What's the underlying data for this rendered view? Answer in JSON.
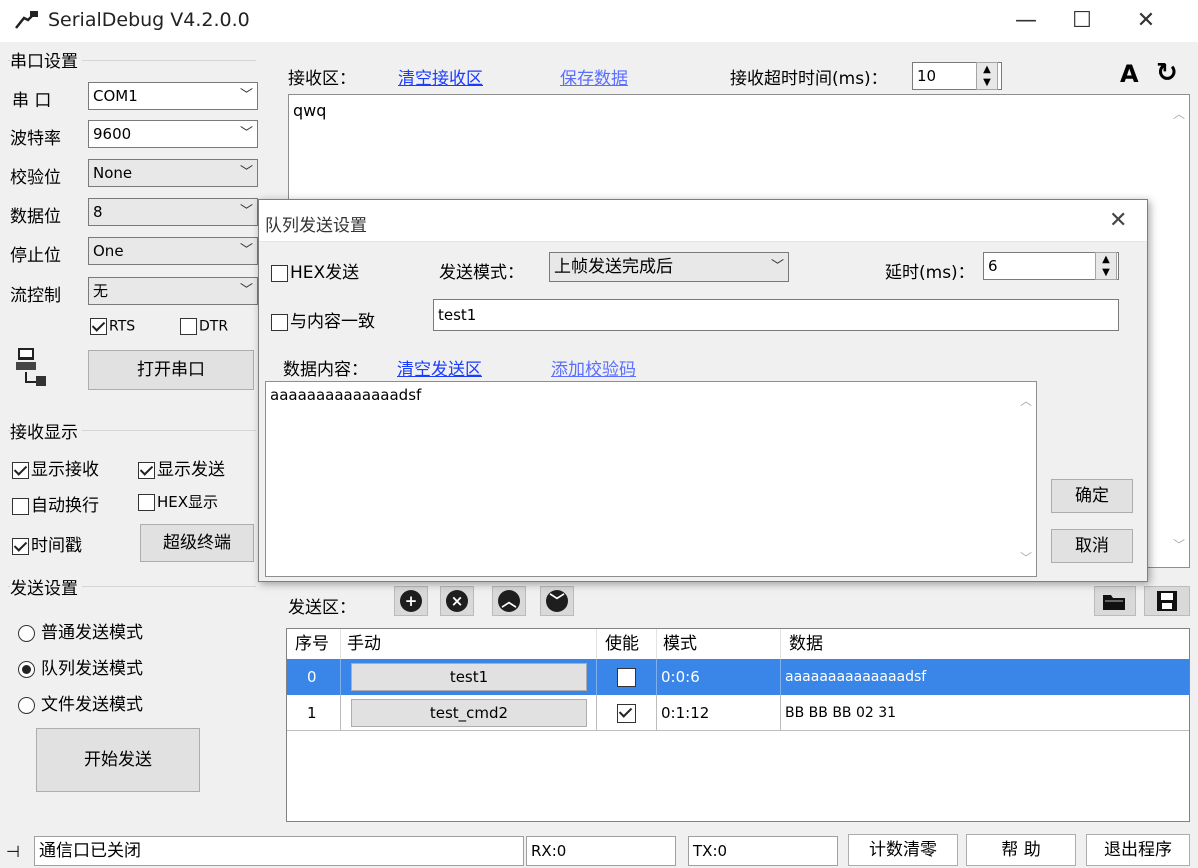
{
  "window": {
    "title": "SerialDebug V4.2.0.0",
    "min": "—",
    "max": "☐",
    "close": "✕"
  },
  "serial_settings": {
    "group_title": "串口设置",
    "port_label": "串  口",
    "port_value": "COM1",
    "baud_label": "波特率",
    "baud_value": "9600",
    "parity_label": "校验位",
    "parity_value": "None",
    "databits_label": "数据位",
    "databits_value": "8",
    "stopbits_label": "停止位",
    "stopbits_value": "One",
    "flow_label": "流控制",
    "flow_value": "无",
    "rts_label": "RTS",
    "rts_checked": true,
    "dtr_label": "DTR",
    "dtr_checked": false,
    "open_button": "打开串口"
  },
  "receive_display": {
    "group_title": "接收显示",
    "show_recv": "显示接收",
    "show_recv_checked": true,
    "show_send": "显示发送",
    "show_send_checked": true,
    "auto_wrap": "自动换行",
    "auto_wrap_checked": false,
    "hex_display": "HEX显示",
    "hex_display_checked": false,
    "timestamp": "时间戳",
    "timestamp_checked": true,
    "super_terminal": "超级终端"
  },
  "send_settings": {
    "group_title": "发送设置",
    "normal_mode": "普通发送模式",
    "queue_mode": "队列发送模式",
    "file_mode": "文件发送模式",
    "selected": "queue",
    "start_button": "开始发送"
  },
  "receive_area": {
    "label": "接收区：",
    "clear_link": "清空接收区",
    "save_link": "保存数据",
    "timeout_label": "接收超时时间(ms)：",
    "timeout_value": "10",
    "content": "qwq"
  },
  "send_area": {
    "label": "发送区：",
    "columns": [
      "序号",
      "手动",
      "使能",
      "模式",
      "数据"
    ],
    "rows": [
      {
        "index": "0",
        "name": "test1",
        "enabled": false,
        "mode": "0:0:6",
        "data": "aaaaaaaaaaaaaadsf",
        "selected": true
      },
      {
        "index": "1",
        "name": "test_cmd2",
        "enabled": true,
        "mode": "0:1:12",
        "data": "BB BB BB 02 31",
        "selected": false
      }
    ]
  },
  "dialog": {
    "title": "队列发送设置",
    "hex_send": "HEX发送",
    "hex_send_checked": false,
    "send_mode_label": "发送模式：",
    "send_mode_value": "上帧发送完成后",
    "delay_label": "延时(ms)：",
    "delay_value": "6",
    "same_as_content": "与内容一致",
    "same_as_content_checked": false,
    "name_value": "test1",
    "data_label": "数据内容：",
    "clear_link": "清空发送区",
    "add_checksum_link": "添加校验码",
    "data_content": "aaaaaaaaaaaaaadsf",
    "ok_button": "确定",
    "cancel_button": "取消"
  },
  "statusbar": {
    "status_text": "通信口已关闭",
    "rx": "RX:0",
    "tx": "TX:0",
    "reset_count": "计数清零",
    "help": "帮  助",
    "exit": "退出程序"
  }
}
